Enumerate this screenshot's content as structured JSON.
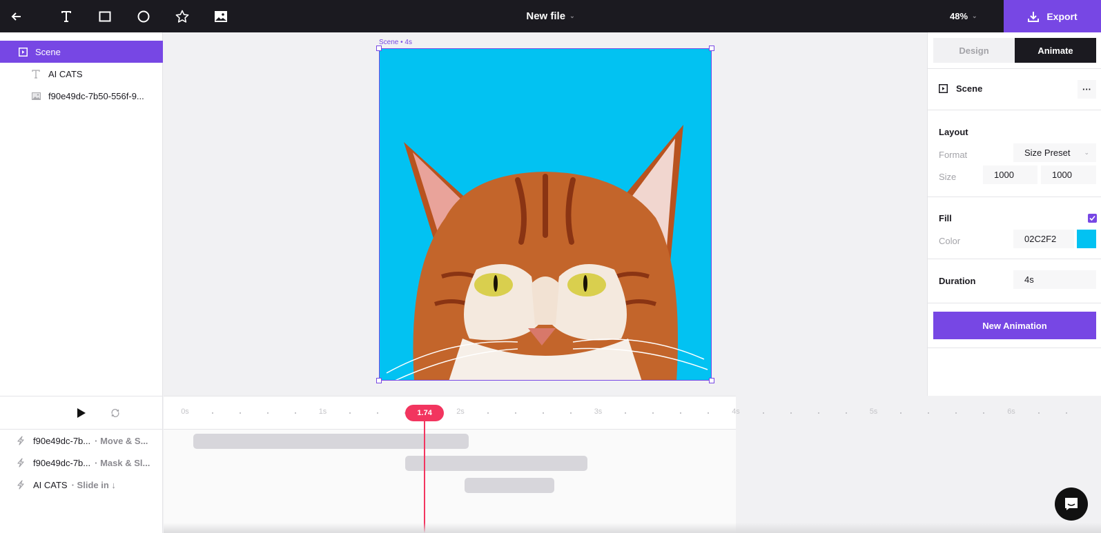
{
  "topbar": {
    "tools": [
      {
        "name": "back",
        "icon": "arrow-left-icon"
      },
      {
        "name": "text",
        "icon": "text-icon"
      },
      {
        "name": "rectangle",
        "icon": "rectangle-icon"
      },
      {
        "name": "ellipse",
        "icon": "circle-icon"
      },
      {
        "name": "star",
        "icon": "star-icon"
      },
      {
        "name": "image",
        "icon": "image-icon"
      }
    ],
    "file_title": "New file",
    "zoom_level": "48%",
    "export_label": "Export"
  },
  "layers": {
    "items": [
      {
        "label": "Scene",
        "icon": "scene-icon",
        "selected": true
      },
      {
        "label": "AI CATS",
        "icon": "text-icon",
        "selected": false
      },
      {
        "label": "f90e49dc-7b50-556f-9...",
        "icon": "image-icon",
        "selected": false
      }
    ]
  },
  "canvas": {
    "scene_label": "Scene • 4s",
    "background_color": "#02C2F2"
  },
  "properties": {
    "tabs": [
      {
        "label": "Design",
        "active": false
      },
      {
        "label": "Animate",
        "active": true
      }
    ],
    "header": {
      "label": "Scene",
      "more_icon": "more-horizontal-icon"
    },
    "layout": {
      "title": "Layout",
      "format_label": "Format",
      "format_value": "Size Preset",
      "size_label": "Size",
      "width": "1000",
      "height": "1000"
    },
    "fill": {
      "title": "Fill",
      "enabled": true,
      "color_label": "Color",
      "color_value": "02C2F2",
      "swatch": "#02C2F2"
    },
    "duration": {
      "title": "Duration",
      "value": "4s"
    },
    "new_animation_label": "New Animation"
  },
  "timeline": {
    "ruler_labels": [
      "0s",
      "1s",
      "2s",
      "3s",
      "4s",
      "5s",
      "6s"
    ],
    "scene_duration_s": 4,
    "playhead_value": "1.74",
    "playhead_s": 1.74,
    "tracks": [
      {
        "target": "f90e49dc-7b...",
        "animation": "· Move & S...",
        "start_s": 0.06,
        "end_s": 2.06
      },
      {
        "target": "f90e49dc-7b...",
        "animation": "· Mask & Sl...",
        "start_s": 1.6,
        "end_s": 2.92
      },
      {
        "target": "AI CATS",
        "animation": "· Slide in ↓",
        "start_s": 2.03,
        "end_s": 2.68
      }
    ]
  },
  "colors": {
    "accent": "#7747E4",
    "topbar": "#1B1A20",
    "playhead": "#F2355F"
  }
}
